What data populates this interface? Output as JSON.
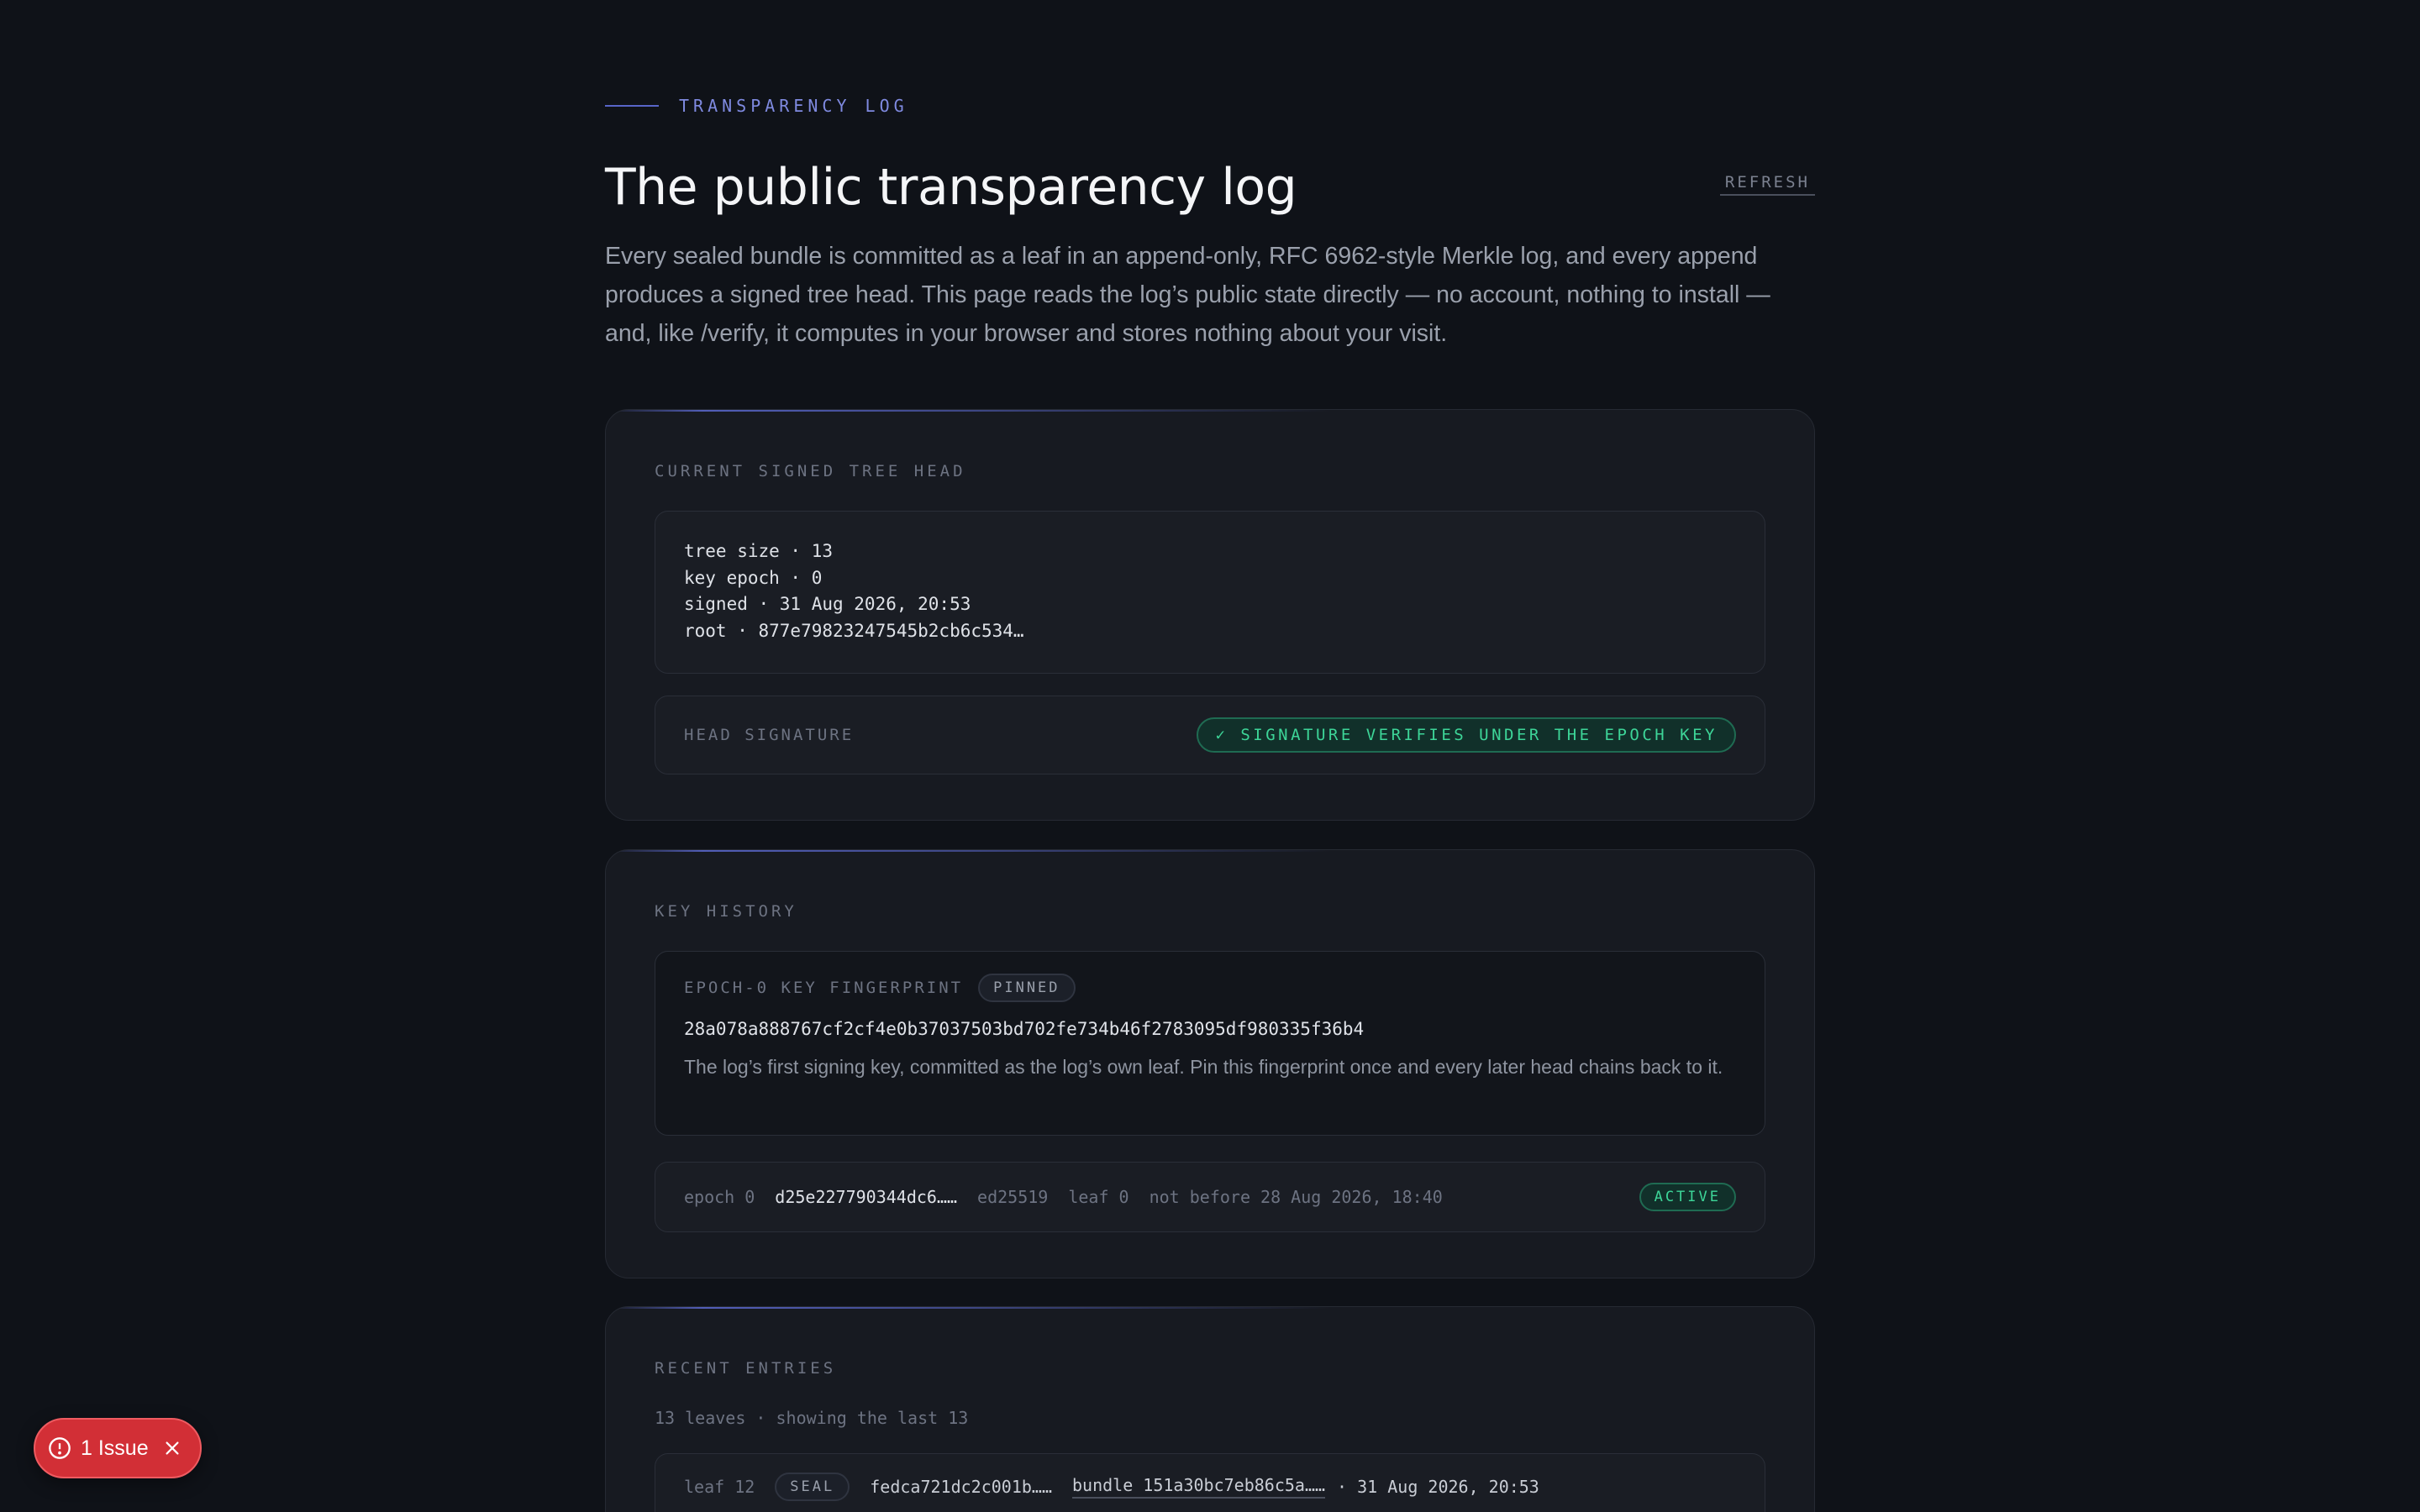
{
  "eyebrow": "TRANSPARENCY LOG",
  "header": {
    "title": "The public transparency log",
    "refresh_label": "REFRESH",
    "intro": "Every sealed bundle is committed as a leaf in an append-only, RFC 6962-style Merkle log, and every append produces a signed tree head. This page reads the log’s public state directly — no account, nothing to install — and, like /verify, it computes in your browser and stores nothing about your visit."
  },
  "sth": {
    "label": "CURRENT SIGNED TREE HEAD",
    "lines": [
      "tree size · 13",
      "key epoch · 0",
      "signed · 31 Aug 2026, 20:53",
      "root · 877e79823247545b2cb6c534…"
    ],
    "signature_label": "HEAD SIGNATURE",
    "signature_status": "✓ SIGNATURE VERIFIES UNDER THE EPOCH KEY"
  },
  "key_history": {
    "label": "KEY HISTORY",
    "fingerprint_label": "EPOCH-0 KEY FINGERPRINT",
    "pinned_badge": "PINNED",
    "fingerprint": "28a078a888767cf2cf4e0b37037503bd702fe734b46f2783095df980335f36b4",
    "description": "The log’s first signing key, committed as the log’s own leaf. Pin this fingerprint once and every later head chains back to it.",
    "epochs": [
      {
        "epoch": "epoch 0",
        "key": "d25e227790344dc6……",
        "algo": "ed25519",
        "leaf": "leaf 0",
        "not_before": "not before 28 Aug 2026, 18:40",
        "status": "ACTIVE"
      }
    ]
  },
  "recent": {
    "label": "RECENT ENTRIES",
    "meta": "13 leaves · showing the last 13",
    "entries": [
      {
        "leaf": "leaf 12",
        "type": "SEAL",
        "hash": "fedca721dc2c001b……",
        "bundle": "bundle 151a30bc7eb86c5a……",
        "time": "· 31 Aug 2026, 20:53"
      }
    ]
  },
  "issue_toast": {
    "label": "1 Issue"
  },
  "colors": {
    "background": "#0f1218",
    "card": "#171a21",
    "accent": "#5865c8",
    "success": "#3dd598",
    "danger": "#d22f36"
  },
  "icons": [
    "alert-circle-icon",
    "close-icon"
  ]
}
